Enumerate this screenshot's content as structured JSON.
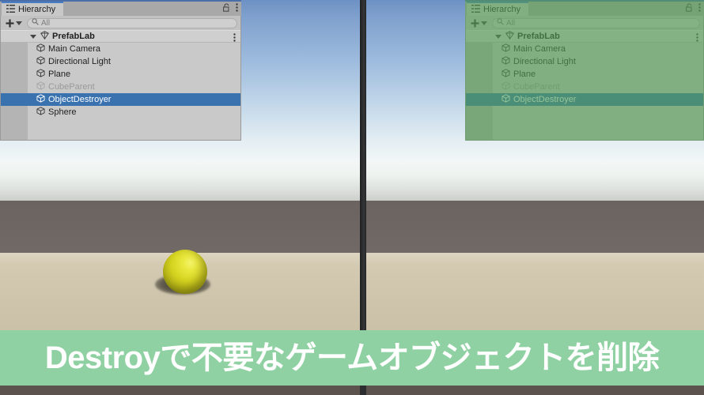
{
  "caption": {
    "text": "Destroyで不要なゲームオブジェクトを削除",
    "background_color": "#8fd1a2",
    "text_color": "#ffffff"
  },
  "panels": [
    {
      "id": "before",
      "tab_label": "Hierarchy",
      "tab_icon": "hierarchy-list-icon",
      "lock_icon": "lock-open-icon",
      "menu_icon": "kebab-menu-icon",
      "add_button_label": "+",
      "add_button_dropdown_icon": "chevron-down-icon",
      "search": {
        "value": "All",
        "placeholder": "All",
        "icon": "search-icon"
      },
      "scene_row": {
        "label": "PrefabLab",
        "icon": "unity-scene-icon",
        "expander": "triangle-down-icon",
        "menu_icon": "kebab-menu-icon"
      },
      "items": [
        {
          "label": "Main Camera",
          "icon": "gameobject-cube-icon",
          "state": "normal"
        },
        {
          "label": "Directional Light",
          "icon": "gameobject-cube-icon",
          "state": "normal"
        },
        {
          "label": "Plane",
          "icon": "gameobject-cube-icon",
          "state": "normal"
        },
        {
          "label": "CubeParent",
          "icon": "gameobject-cube-icon",
          "state": "disabled"
        },
        {
          "label": "ObjectDestroyer",
          "icon": "gameobject-cube-icon",
          "state": "selected"
        },
        {
          "label": "Sphere",
          "icon": "gameobject-cube-icon",
          "state": "normal"
        }
      ],
      "selection_color": "#3a72b0",
      "tinted": false
    },
    {
      "id": "after",
      "tab_label": "Hierarchy",
      "tab_icon": "hierarchy-list-icon",
      "lock_icon": "lock-open-icon",
      "menu_icon": "kebab-menu-icon",
      "add_button_label": "+",
      "add_button_dropdown_icon": "chevron-down-icon",
      "search": {
        "value": "All",
        "placeholder": "All",
        "icon": "search-icon"
      },
      "scene_row": {
        "label": "PrefabLab",
        "icon": "unity-scene-icon",
        "expander": "triangle-down-icon",
        "menu_icon": "kebab-menu-icon"
      },
      "items": [
        {
          "label": "Main Camera",
          "icon": "gameobject-cube-icon",
          "state": "normal"
        },
        {
          "label": "Directional Light",
          "icon": "gameobject-cube-icon",
          "state": "normal"
        },
        {
          "label": "Plane",
          "icon": "gameobject-cube-icon",
          "state": "normal"
        },
        {
          "label": "CubeParent",
          "icon": "gameobject-cube-icon",
          "state": "disabled"
        },
        {
          "label": "ObjectDestroyer",
          "icon": "gameobject-cube-icon",
          "state": "selected"
        }
      ],
      "selection_color": "#3a72b0",
      "tinted": true,
      "tint_color": "#56a056"
    }
  ],
  "scene_views": [
    {
      "id": "scene-before",
      "sky": "blue-white-gradient",
      "ground_color": "#726a66",
      "plane_color": "#cec4ab",
      "objects": [
        {
          "name": "sphere",
          "color": "#e0df2c",
          "has_shadow": true
        }
      ]
    },
    {
      "id": "scene-after",
      "sky": "blue-white-gradient",
      "ground_color": "#726a66",
      "plane_color": "#cec4ab",
      "objects": []
    }
  ]
}
